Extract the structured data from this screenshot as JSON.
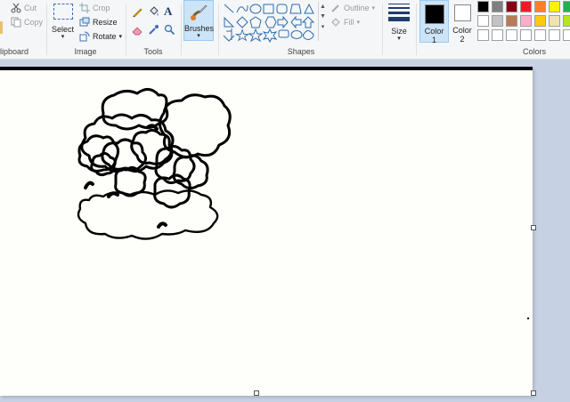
{
  "ribbon": {
    "clipboard": {
      "label": "lipboard",
      "cut": "Cut",
      "copy": "Copy"
    },
    "image": {
      "label": "Image",
      "select": "Select",
      "crop": "Crop",
      "resize": "Resize",
      "rotate": "Rotate"
    },
    "tools": {
      "label": "Tools"
    },
    "brushes": {
      "label": "Brushes"
    },
    "shapes": {
      "label": "Shapes",
      "outline": "Outline",
      "fill": "Fill"
    },
    "size": {
      "label": "Size"
    },
    "color1": {
      "label_line1": "Color",
      "label_line2": "1",
      "value": "#000000"
    },
    "color2": {
      "label_line1": "Color",
      "label_line2": "2",
      "value": "#ffffff"
    },
    "colors": {
      "label": "Colors",
      "row1": [
        "#000000",
        "#7f7f7f",
        "#880015",
        "#ed1c24",
        "#ff7f27",
        "#fff200",
        "#22b14c"
      ],
      "row2": [
        "#ffffff",
        "#c3c3c3",
        "#b97a57",
        "#ffaec9",
        "#ffc90e",
        "#efe4b0",
        "#b5e61d"
      ],
      "row3": [
        "#ffffff",
        "#ffffff",
        "#ffffff",
        "#ffffff",
        "#ffffff",
        "#ffffff",
        "#ffffff"
      ]
    }
  },
  "colors": {
    "accent": "#2b7fd1",
    "selected_bg": "#cce4f7",
    "canvas_bg": "#fefefb",
    "workspace_bg": "#c6d2e3"
  },
  "canvas": {
    "drawing": "black outline sketch of clouds"
  }
}
